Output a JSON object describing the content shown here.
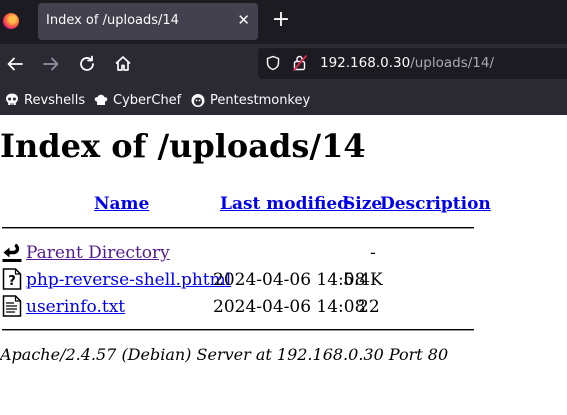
{
  "browser": {
    "tab": {
      "title": "Index of /uploads/14",
      "close_glyph": "✕"
    },
    "new_tab_glyph": "+",
    "url": {
      "host": "192.168.0.30",
      "path": "/uploads/14/"
    },
    "bookmarks": [
      {
        "label": "Revshells",
        "icon": "skull-icon"
      },
      {
        "label": "CyberChef",
        "icon": "chef-icon"
      },
      {
        "label": "Pentestmonkey",
        "icon": "monkey-icon"
      }
    ]
  },
  "page": {
    "title": "Index of /uploads/14",
    "columns": {
      "name": "Name",
      "last_modified": "Last modified",
      "size": "Size",
      "description": "Description"
    },
    "rows": [
      {
        "name": "Parent Directory",
        "modified": "",
        "size": "-",
        "description": "",
        "icon": "back-icon",
        "visited": true
      },
      {
        "name": "php-reverse-shell.phtml",
        "modified": "2024-04-06 14:08",
        "size": "5.4K",
        "description": "",
        "icon": "unknown-file-icon",
        "visited": false
      },
      {
        "name": "userinfo.txt",
        "modified": "2024-04-06 14:08",
        "size": "22",
        "description": "",
        "icon": "text-file-icon",
        "visited": false
      }
    ],
    "footer": "Apache/2.4.57 (Debian) Server at 192.168.0.30 Port 80"
  },
  "colors": {
    "link": "#0000ee",
    "visited": "#551a8b",
    "chrome_dark": "#1c1b22",
    "chrome": "#2b2a33",
    "tab_active": "#42414d"
  }
}
